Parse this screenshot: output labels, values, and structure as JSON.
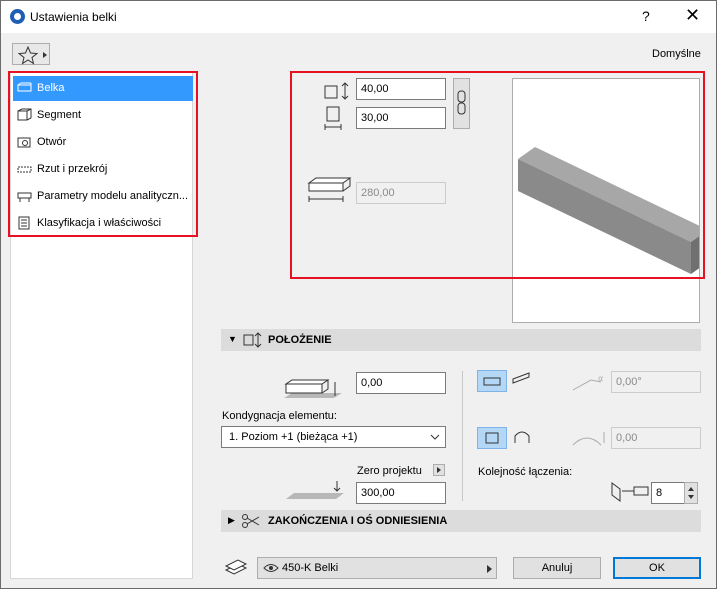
{
  "window": {
    "title": "Ustawienia belki",
    "help": "?",
    "close": "✕"
  },
  "header": {
    "defaults_label": "Domyślne"
  },
  "sidebar": {
    "items": [
      {
        "label": "Belka",
        "icon": "beam-icon"
      },
      {
        "label": "Segment",
        "icon": "segment-icon"
      },
      {
        "label": "Otwór",
        "icon": "hole-icon"
      },
      {
        "label": "Rzut i przekrój",
        "icon": "floorplan-icon"
      },
      {
        "label": "Parametry modelu analityczn...",
        "icon": "analytical-icon"
      },
      {
        "label": "Klasyfikacja i właściwości",
        "icon": "classification-icon"
      }
    ]
  },
  "geometry": {
    "height": "40,00",
    "width": "30,00",
    "length": "280,00"
  },
  "positioning": {
    "title": "POŁOŻENIE",
    "offset_value": "0,00",
    "story_label": "Kondygnacja elementu:",
    "story_value": "1. Poziom +1 (bieżąca +1)",
    "reference_label": "Zero projektu",
    "reference_value": "300,00",
    "slant_angle": "0,00°",
    "arc_value": "0,00",
    "order_label": "Kolejność łączenia:",
    "order_value": "8"
  },
  "ends_section": {
    "title": "ZAKOŃCZENIA I OŚ ODNIESIENIA"
  },
  "footer": {
    "layer": "450-K Belki",
    "cancel": "Anuluj",
    "ok": "OK"
  },
  "colors": {
    "selection": "#3399ff",
    "highlight_box": "#e81123",
    "beam": "#8c8c8c"
  }
}
